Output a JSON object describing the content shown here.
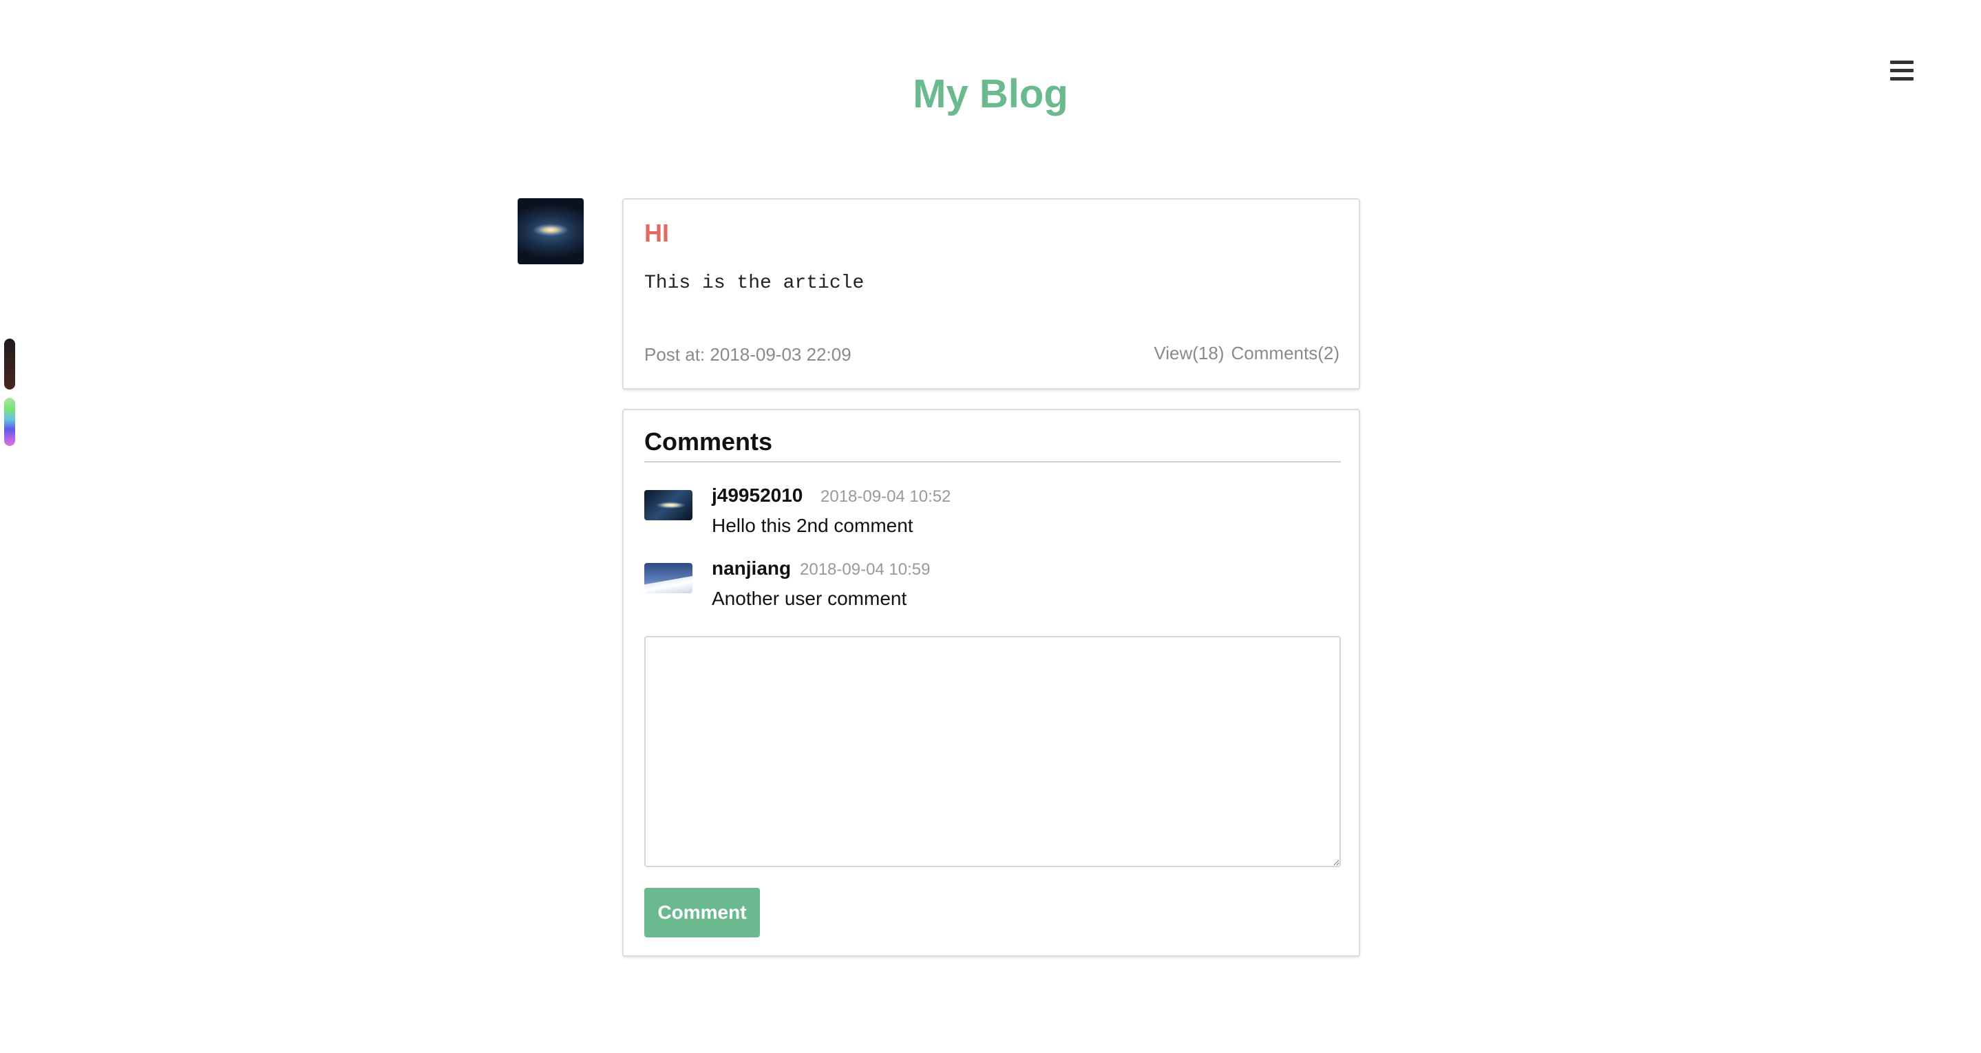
{
  "header": {
    "site_title": "My Blog",
    "menu_icon": "hamburger-menu-icon"
  },
  "post": {
    "title": "HI",
    "body": "This is the article",
    "posted_at": "Post at: 2018-09-03 22:09",
    "views": "View(18)",
    "comments_count": "Comments(2)"
  },
  "comments_section": {
    "heading": "Comments",
    "items": [
      {
        "user": "j49952010",
        "time": "2018-09-04 10:52",
        "text": "Hello this 2nd comment"
      },
      {
        "user": "nanjiang",
        "time": "2018-09-04 10:59",
        "text": "Another user comment"
      }
    ],
    "textarea_value": "",
    "submit_label": "Comment"
  },
  "colors": {
    "accent_green": "#6bba8f",
    "title_red": "#e26a63",
    "muted_gray": "#8a8a8a"
  }
}
